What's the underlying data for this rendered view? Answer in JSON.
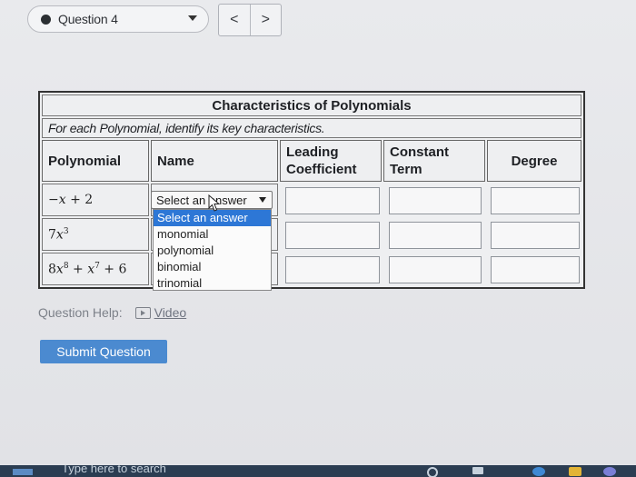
{
  "nav": {
    "question_label": "Question 4",
    "prev_symbol": "<",
    "next_symbol": ">"
  },
  "table": {
    "title": "Characteristics of Polynomials",
    "instruction": "For each Polynomial, identify its key characteristics.",
    "headers": {
      "polynomial": "Polynomial",
      "name": "Name",
      "leading_line1": "Leading",
      "leading_line2": "Coefficient",
      "constant_line1": "Constant",
      "constant_line2": "Term",
      "degree": "Degree"
    },
    "rows": [
      {
        "polynomial": "−x + 2"
      },
      {
        "polynomial": "7x^3"
      },
      {
        "polynomial": "8x^8 + x^7 + 6"
      }
    ]
  },
  "select": {
    "value": "Select an answer",
    "options": [
      "Select an answer",
      "monomial",
      "polynomial",
      "binomial",
      "trinomial"
    ]
  },
  "help": {
    "label": "Question Help:",
    "video": "Video"
  },
  "submit_label": "Submit Question",
  "taskbar": {
    "search_text": "Type here to search"
  }
}
